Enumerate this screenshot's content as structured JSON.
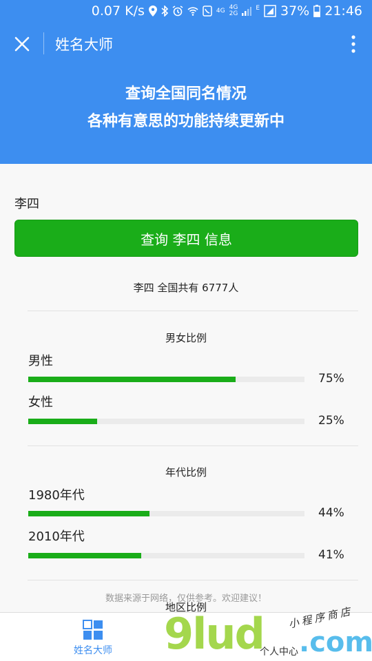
{
  "status_bar": {
    "speed": "0.07 K/s",
    "net1": "4G",
    "net2": "4G",
    "net3": "2G",
    "net4": "E",
    "battery": "37%",
    "time": "21:46"
  },
  "nav": {
    "title": "姓名大师"
  },
  "banner": {
    "line1": "查询全国同名情况",
    "line2": "各种有意思的功能持续更新中"
  },
  "query": {
    "name": "李四",
    "button_label": "查询 李四 信息"
  },
  "result": {
    "total_text": "李四 全国共有 6777人",
    "gender": {
      "title": "男女比例",
      "items": [
        {
          "label": "男性",
          "percent_text": "75%",
          "value": 75
        },
        {
          "label": "女性",
          "percent_text": "25%",
          "value": 25
        }
      ]
    },
    "era": {
      "title": "年代比例",
      "items": [
        {
          "label": "1980年代",
          "percent_text": "44%",
          "value": 44
        },
        {
          "label": "2010年代",
          "percent_text": "41%",
          "value": 41
        }
      ]
    },
    "region": {
      "title": "地区比例"
    }
  },
  "footer_note": "数据来源于网络，仅供参考。欢迎建议！",
  "tabbar": {
    "tabs": [
      {
        "label": "姓名大师",
        "icon": "grid-icon",
        "active": true
      },
      {
        "label": "个人中心",
        "icon": "person-icon",
        "active": false
      }
    ]
  },
  "watermark": {
    "logo": "9lud",
    "suffix": ".com",
    "store": "小程序商店"
  },
  "colors": {
    "primary_blue": "#3d8ef0",
    "accent_green": "#1aad19",
    "track_gray": "#ebebeb"
  }
}
